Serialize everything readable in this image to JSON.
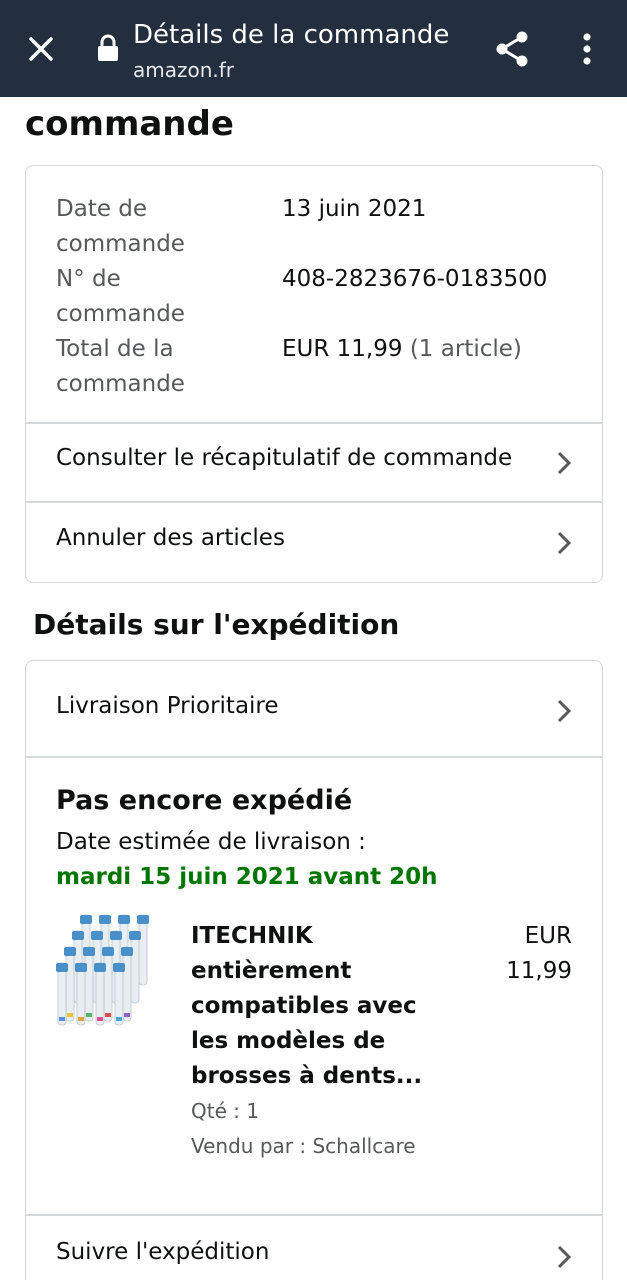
{
  "topbar": {
    "title": "Détails de la commande",
    "domain": "amazon.fr",
    "close_icon": "close-icon",
    "lock_icon": "lock-icon",
    "share_icon": "share-icon",
    "more_icon": "more-vertical-icon",
    "background": "#232f3e"
  },
  "page": {
    "heading": "commande"
  },
  "order_summary": {
    "date_label_1": "Date de",
    "date_label_2": "commande",
    "date_value": "13 juin 2021",
    "number_label_1": "N° de",
    "number_label_2": "commande",
    "number_value": "408-2823676-0183500",
    "total_label_1": "Total de la",
    "total_label_2": "commande",
    "total_value": "EUR 11,99",
    "total_items": "(1 article)"
  },
  "links": {
    "recap": "Consulter le récapitulatif de commande",
    "cancel": "Annuler des articles",
    "delivery": "Livraison Prioritaire",
    "track": "Suivre l'expédition"
  },
  "shipping": {
    "section_title": "Détails sur l'expédition",
    "status": "Pas encore expédié",
    "estimate_label": "Date estimée de livraison :",
    "estimate_date": "mardi 15 juin 2021 avant 20h",
    "estimate_color": "#007600"
  },
  "product": {
    "title_lines": [
      "ITECHNIK",
      "entièrement",
      "compatibles avec",
      "les modèles de",
      "brosses à dents..."
    ],
    "price_currency": "EUR",
    "price_amount": "11,99",
    "quantity": "Qté : 1",
    "seller": "Vendu par : Schallcare",
    "image_icon": "toothbrush-heads-image"
  }
}
